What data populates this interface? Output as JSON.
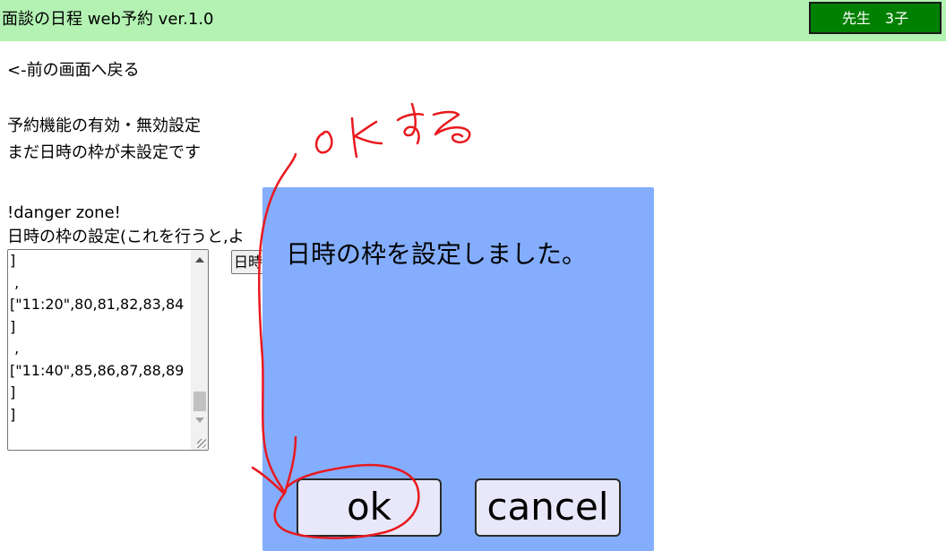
{
  "header": {
    "app_title": "面談の日程 web予約 ver.1.0",
    "user_badge": "先生　3子",
    "bg_color": "#b3f2b3",
    "badge_color": "#008000"
  },
  "main": {
    "back_link": "<-前の画面へ戻る",
    "section_title": "予約機能の有効・無効設定",
    "status_text": "まだ日時の枠が未設定です",
    "danger_label": "!danger zone!",
    "slot_setting_label": "日時の枠の設定(これを行うと,よ",
    "textarea_lines": [
      "]",
      " ,",
      "[\"11:20\",80,81,82,83,84",
      "]",
      " ,",
      "[\"11:40\",85,86,87,88,89",
      "]",
      "]"
    ],
    "set_button_label": "日時"
  },
  "modal": {
    "message": "日時の枠を設定しました。",
    "ok_label": "ok",
    "cancel_label": "cancel",
    "bg_color": "#84aefd"
  },
  "annotation": {
    "handwritten_text": "oKする",
    "ink_color": "#e8191e"
  }
}
